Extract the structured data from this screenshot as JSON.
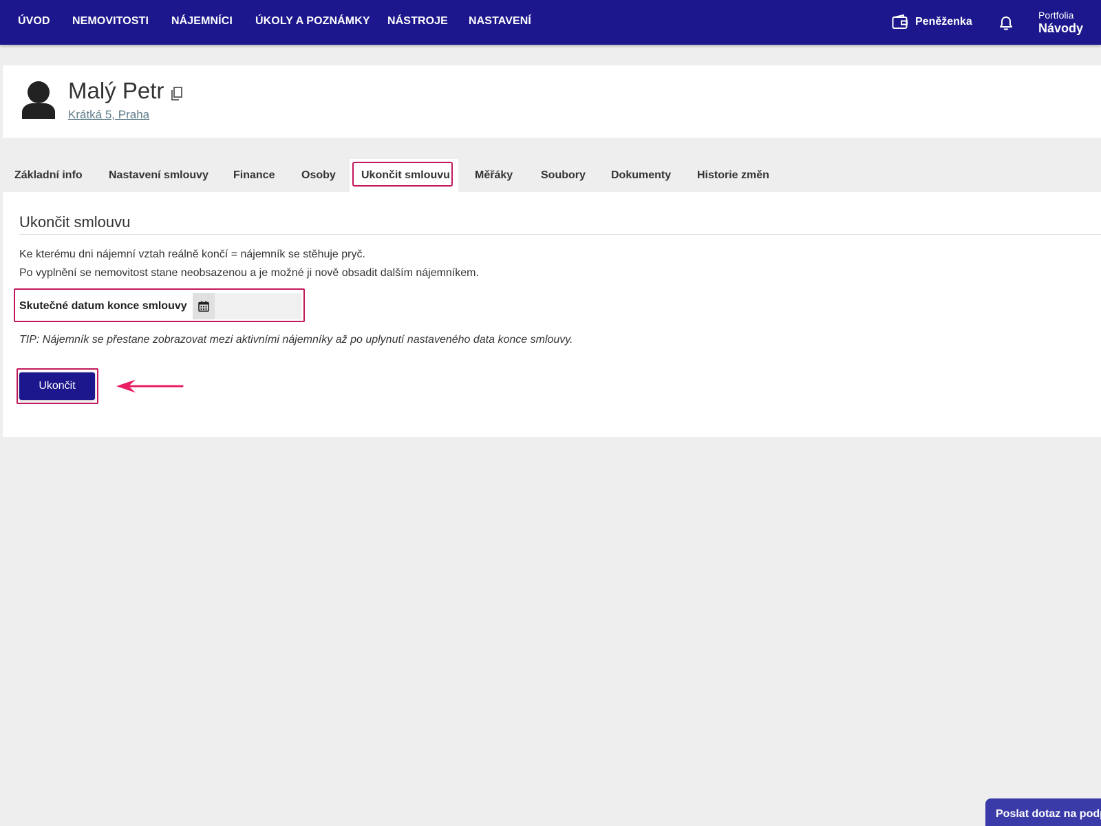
{
  "nav": {
    "items": [
      "ÚVOD",
      "NEMOVITOSTI",
      "NÁJEMNÍCI",
      "ÚKOLY A POZNÁMKY",
      "NÁSTROJE",
      "NASTAVENÍ"
    ],
    "wallet_label": "Peněženka",
    "portfolio_label": "Portfolia",
    "portfolio_value": "Návody",
    "icons": [
      "wallet-icon",
      "bell-icon"
    ]
  },
  "tenant": {
    "name": "Malý Petr",
    "address": "Krátká 5, Praha"
  },
  "tabs": [
    {
      "label": "Základní info"
    },
    {
      "label": "Nastavení smlouvy"
    },
    {
      "label": "Finance"
    },
    {
      "label": "Osoby"
    },
    {
      "label": "Ukončit smlouvu",
      "active": true
    },
    {
      "label": "Měřáky"
    },
    {
      "label": "Soubory"
    },
    {
      "label": "Dokumenty"
    },
    {
      "label": "Historie změn"
    }
  ],
  "section": {
    "title": "Ukončit smlouvu",
    "description_line1": "Ke kterému dni nájemní vztah reálně končí = nájemník se stěhuje pryč.",
    "description_line2": "Po vyplnění se nemovitost stane neobsazenou a je možné ji nově obsadit dalším nájemníkem.",
    "field_label": "Skutečné datum konce smlouvy",
    "field_value": "",
    "tip": "TIP: Nájemník se přestane zobrazovat mezi aktivními nájemníky až po uplynutí nastaveného data konce smlouvy.",
    "submit_label": "Ukončit"
  },
  "support": {
    "label": "Poslat dotaz na podporu"
  },
  "colors": {
    "nav_bg": "#1c178c",
    "highlight": "#c2185b",
    "arrow": "#e91e63",
    "link": "#607d8b",
    "support_bg": "#3a3aa8"
  }
}
